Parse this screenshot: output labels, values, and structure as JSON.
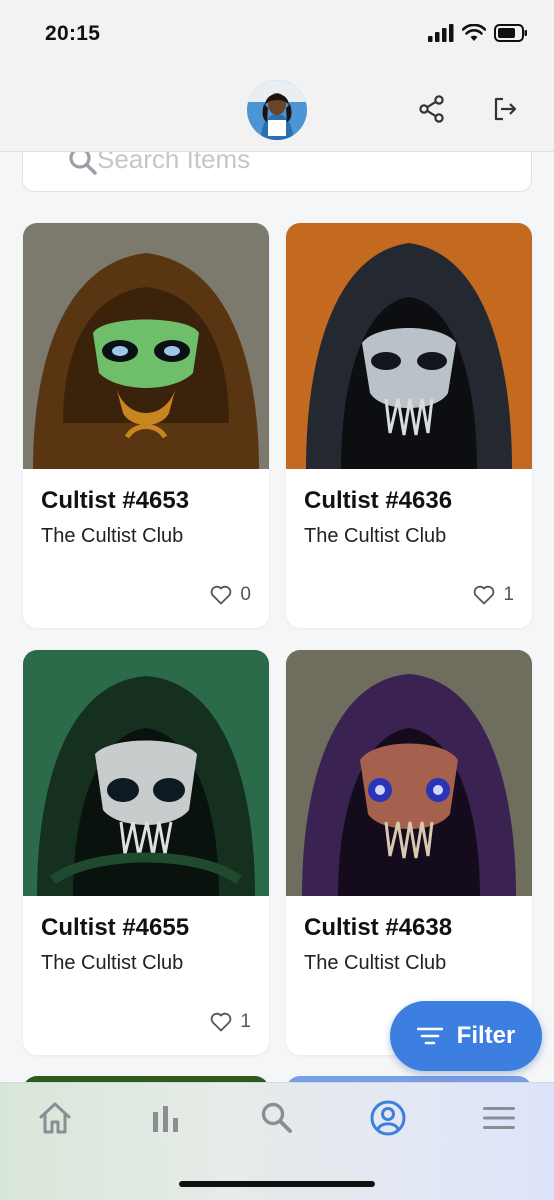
{
  "status_bar": {
    "time": "20:15"
  },
  "search": {
    "placeholder": "Search Items"
  },
  "items": [
    {
      "title": "Cultist #4653",
      "collection": "The Cultist Club",
      "likes": "0",
      "art_bg": "#7b7a6c"
    },
    {
      "title": "Cultist #4636",
      "collection": "The Cultist Club",
      "likes": "1",
      "art_bg": "#c46a20"
    },
    {
      "title": "Cultist #4655",
      "collection": "The Cultist Club",
      "likes": "1",
      "art_bg": "#2b6b4a"
    },
    {
      "title": "Cultist #4638",
      "collection": "The Cultist Club",
      "likes": "",
      "art_bg": "#6f6e5e"
    }
  ],
  "filter_button": {
    "label": "Filter"
  },
  "nav": {
    "items": [
      "home-icon",
      "stats-icon",
      "search-icon",
      "profile-icon",
      "menu-icon"
    ],
    "active": "profile-icon",
    "active_color": "#3d7fe0",
    "inactive_color": "#8a8f94"
  },
  "colors": {
    "accent": "#3d7fe0"
  }
}
